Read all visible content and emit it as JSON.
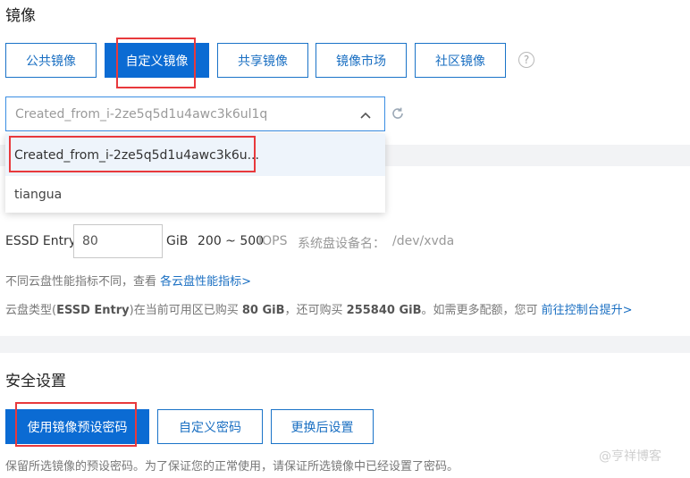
{
  "image_section": {
    "title": "镜像",
    "tabs": [
      {
        "label": "公共镜像",
        "active": false
      },
      {
        "label": "自定义镜像",
        "active": true
      },
      {
        "label": "共享镜像",
        "active": false
      },
      {
        "label": "镜像市场",
        "active": false
      },
      {
        "label": "社区镜像",
        "active": false
      }
    ],
    "help_glyph": "?",
    "select": {
      "value": "Created_from_i-2ze5q5d1u4awc3k6ul1q",
      "caret_icon": "chevron-up-icon",
      "refresh_icon": "refresh-icon"
    },
    "dropdown_options": [
      {
        "label": "Created_from_i-2ze5q5d1u4awc3k6u...",
        "selected": true
      },
      {
        "label": "tiangua",
        "selected": false
      }
    ]
  },
  "disk": {
    "type_label": "ESSD Entry",
    "size_value": "80",
    "unit": "GiB",
    "iops_range": "200 ~ 500",
    "iops_unit": "IOPS",
    "device_label": "系统盘设备名：",
    "device_value": "/dev/xvda",
    "perf_note": "不同云盘性能指标不同，查看",
    "perf_link": "各云盘性能指标>",
    "quota_prefix": "云盘类型(",
    "quota_type": "ESSD Entry",
    "quota_mid1": ")在当前可用区已购买 ",
    "quota_bought": "80 GiB",
    "quota_mid2": "，还可购买 ",
    "quota_remaining": "255840 GiB",
    "quota_mid3": "。如需更多配额，您可 ",
    "quota_link": "前往控制台提升>"
  },
  "security": {
    "title": "安全设置",
    "options": [
      {
        "label": "使用镜像预设密码",
        "active": true
      },
      {
        "label": "自定义密码",
        "active": false
      },
      {
        "label": "更换后设置",
        "active": false
      }
    ],
    "note": "保留所选镜像的预设密码。为了保证您的正常使用，请保证所选镜像中已经设置了密码。"
  },
  "watermark": "@亨祥博客",
  "colors": {
    "primary": "#0b6bd3",
    "link": "#1a6fc2",
    "highlight_box": "#e8393c"
  }
}
